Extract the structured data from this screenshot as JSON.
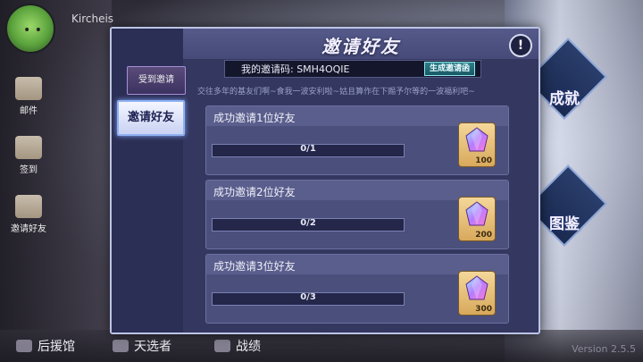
{
  "player": {
    "name": "Kircheis"
  },
  "side_menu": [
    {
      "label": "邮件"
    },
    {
      "label": "签到"
    },
    {
      "label": "邀请好友"
    }
  ],
  "right_menu": {
    "achievement": "成就",
    "codex": "图鉴"
  },
  "bottom_bar": {
    "items": [
      "后援馆",
      "天选者",
      "战绩"
    ],
    "version": "Version 2.5.5"
  },
  "dialog": {
    "title": "邀请好友",
    "tabs": {
      "received": "受到邀请",
      "invite": "邀请好友"
    },
    "invite_code_label": "我的邀请码: SMH4OQIE",
    "generate_button": "生成邀请函",
    "description": "交往多年的基友们啊~食我一波安利啦~姑且算作在下赐予尔等的一波福利吧~",
    "tasks": [
      {
        "title": "成功邀请1位好友",
        "progress_text": "0/1",
        "progress": 0,
        "reward_qty": "100"
      },
      {
        "title": "成功邀请2位好友",
        "progress_text": "0/2",
        "progress": 0,
        "reward_qty": "200"
      },
      {
        "title": "成功邀请3位好友",
        "progress_text": "0/3",
        "progress": 0,
        "reward_qty": "300"
      }
    ]
  }
}
